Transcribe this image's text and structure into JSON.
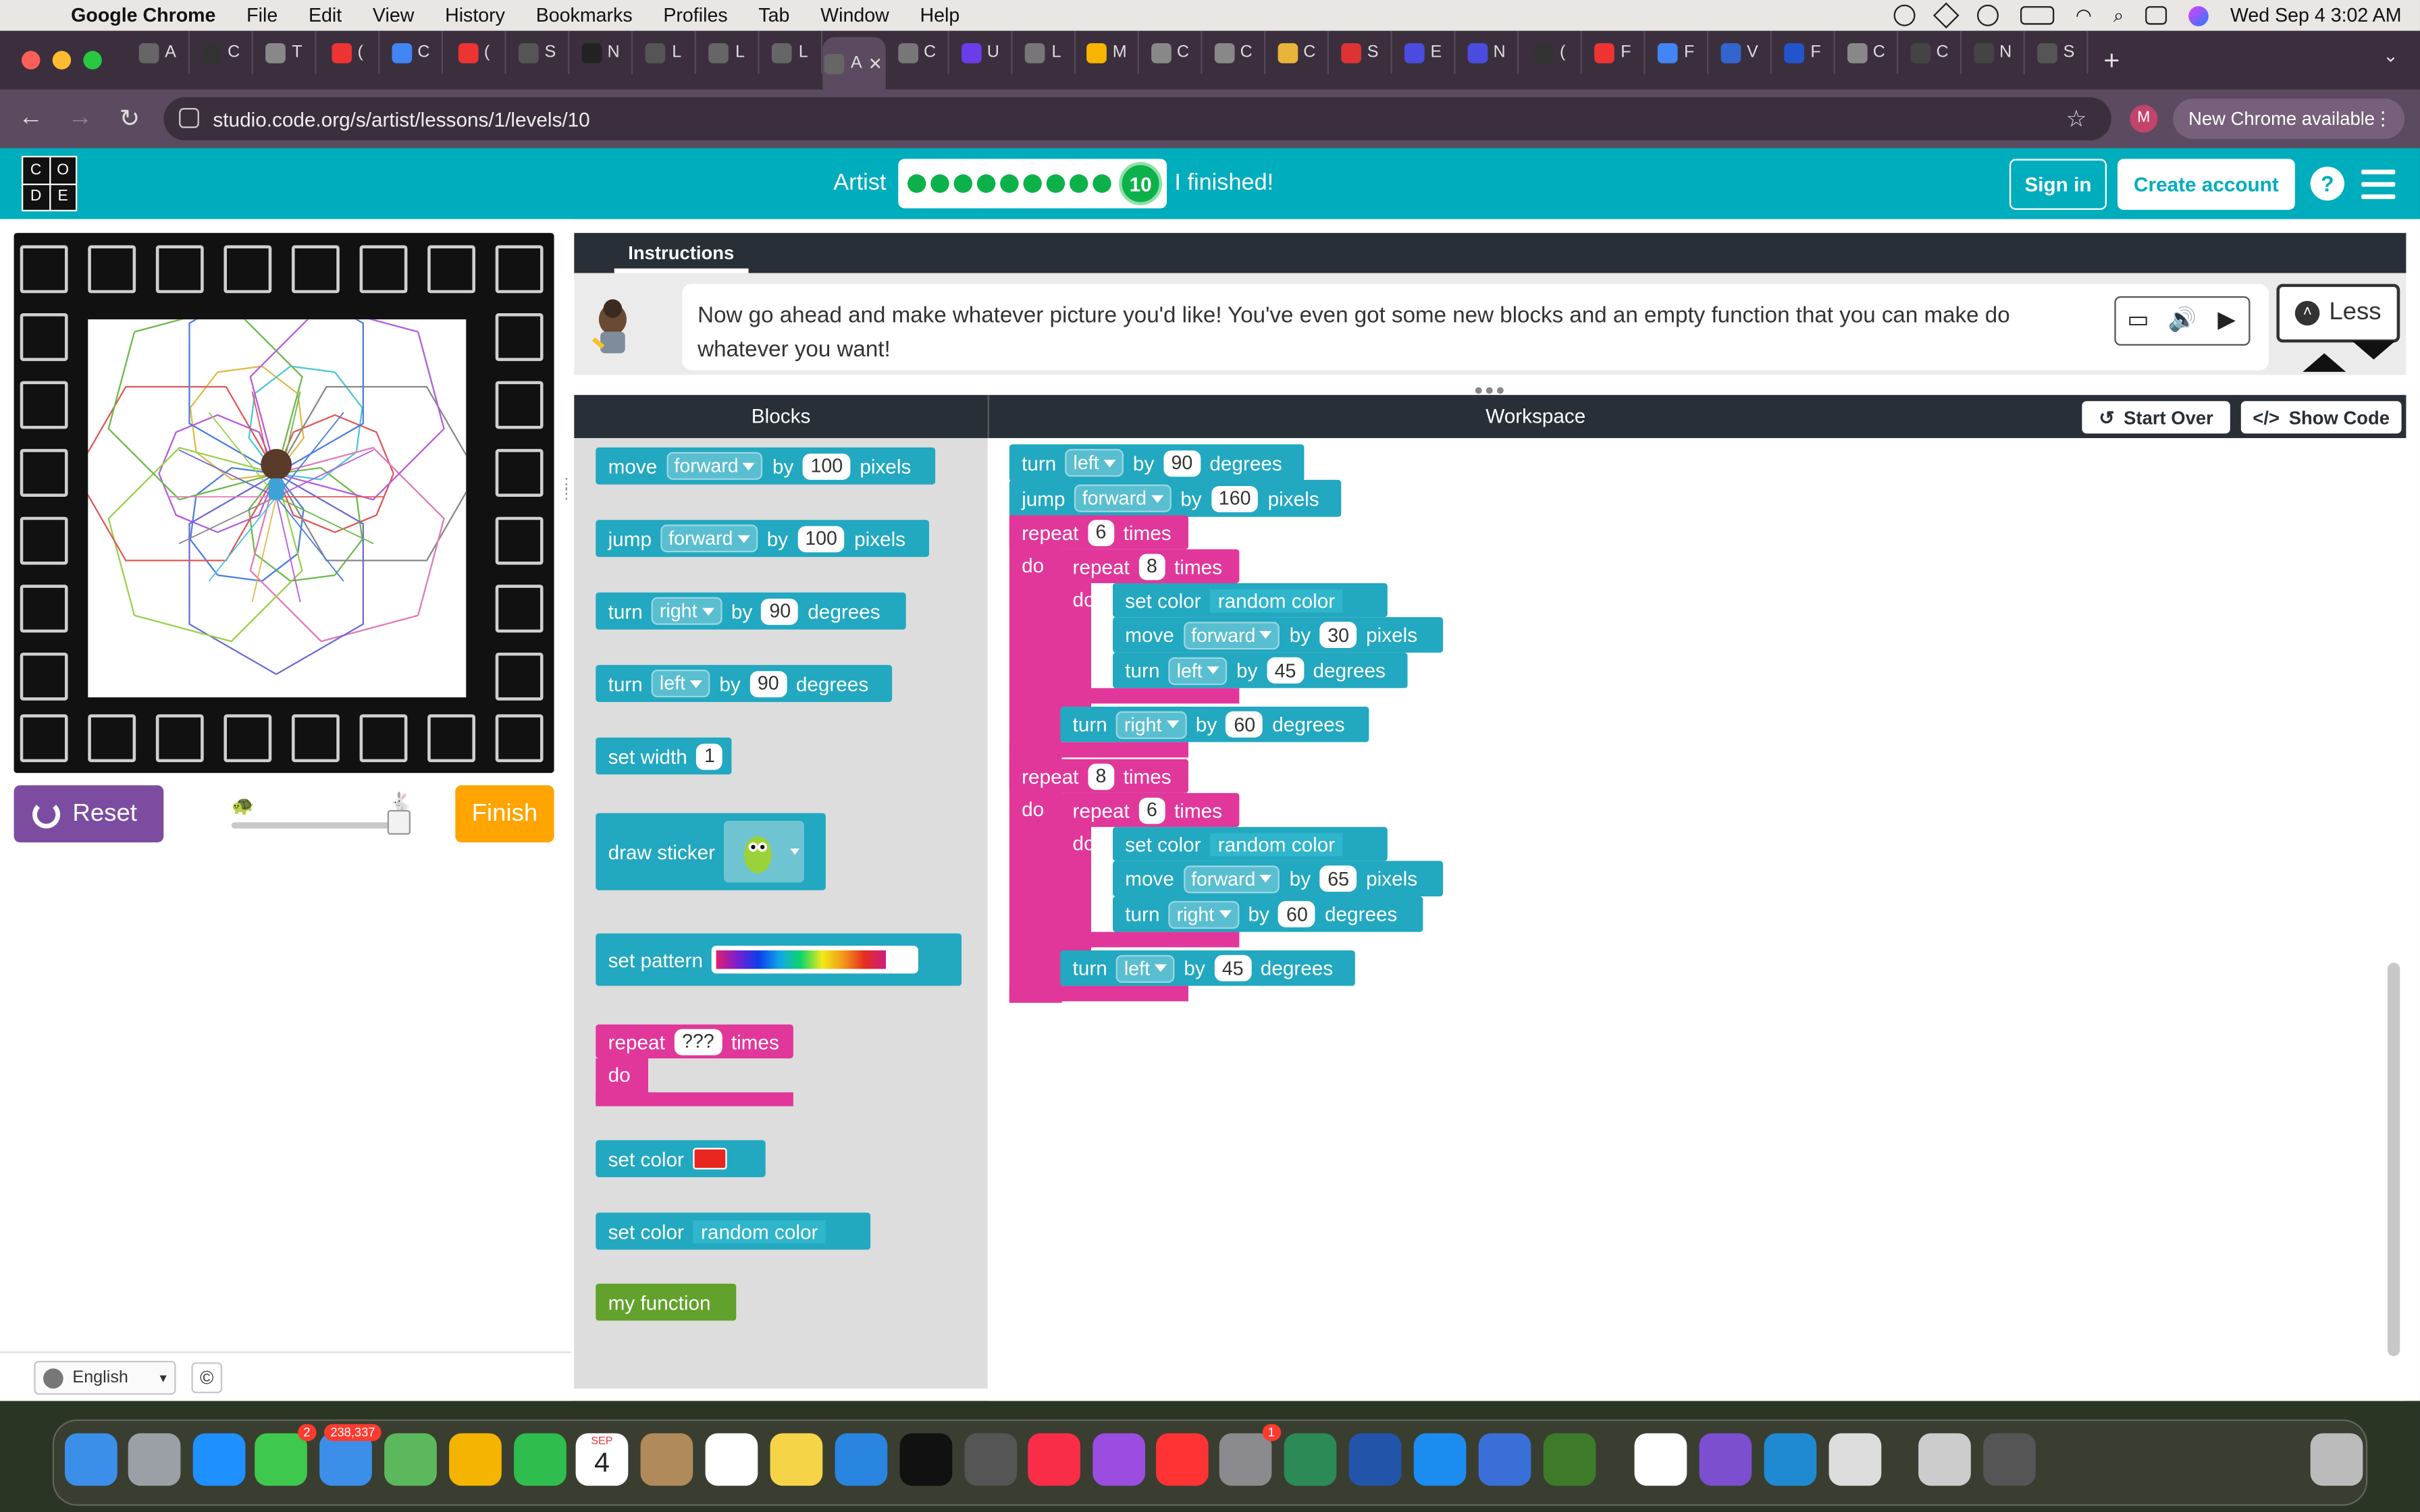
{
  "menubar": {
    "app": "Google Chrome",
    "items": [
      "File",
      "Edit",
      "View",
      "History",
      "Bookmarks",
      "Profiles",
      "Tab",
      "Window",
      "Help"
    ],
    "datetime": "Wed Sep 4  3:02 AM"
  },
  "browser": {
    "url": "studio.code.org/s/artist/lessons/1/levels/10",
    "new_chrome_label": "New Chrome available",
    "profile_initial": "M",
    "tab_letters": [
      "A",
      "C",
      "T",
      "(",
      "C",
      "(",
      "S",
      "N",
      "L",
      "L",
      "L",
      "A",
      "C",
      "U",
      "L",
      "M",
      "C",
      "C",
      "C",
      "S",
      "E",
      "N",
      "(",
      "F",
      "F",
      "V",
      "F",
      "C",
      "C",
      "N",
      "S"
    ]
  },
  "codeorg": {
    "logo_letters": [
      "C",
      "O",
      "D",
      "E"
    ],
    "level_title": "Artist",
    "current_level": "10",
    "finished_label": "I finished!",
    "sign_in": "Sign in",
    "create_account": "Create account",
    "help": "?"
  },
  "left_panel": {
    "reset_label": "Reset",
    "finish_label": "Finish",
    "speed_slider_level": 1.0,
    "language": "English",
    "copyright": "©"
  },
  "instructions": {
    "tab_label": "Instructions",
    "text": "Now go ahead and make whatever picture you'd like! You've even got some new blocks and an empty function that you can make do whatever you want!",
    "less_label": "Less"
  },
  "editor": {
    "blocks_header": "Blocks",
    "workspace_header": "Workspace",
    "start_over": "Start Over",
    "show_code": "Show Code"
  },
  "toolbox": {
    "move_forward": {
      "verb": "move",
      "dir": "forward",
      "by": "by",
      "val": "100",
      "unit": "pixels"
    },
    "jump_forward": {
      "verb": "jump",
      "dir": "forward",
      "by": "by",
      "val": "100",
      "unit": "pixels"
    },
    "turn_right": {
      "verb": "turn",
      "dir": "right",
      "by": "by",
      "val": "90",
      "unit": "degrees"
    },
    "turn_left": {
      "verb": "turn",
      "dir": "left",
      "by": "by",
      "val": "90",
      "unit": "degrees"
    },
    "set_width": {
      "label": "set width",
      "val": "1"
    },
    "draw_sticker": {
      "label": "draw sticker"
    },
    "set_pattern": {
      "label": "set pattern"
    },
    "repeat": {
      "label": "repeat",
      "val": "???",
      "times": "times",
      "do": "do"
    },
    "set_color_red": {
      "label": "set color",
      "color": "#e8261f"
    },
    "set_color_random": {
      "label": "set color",
      "val": "random color"
    },
    "my_function": {
      "label": "my function"
    }
  },
  "workspace": {
    "b1": {
      "verb": "turn",
      "dir": "left",
      "by": "by",
      "val": "90",
      "unit": "degrees"
    },
    "b2": {
      "verb": "jump",
      "dir": "forward",
      "by": "by",
      "val": "160",
      "unit": "pixels"
    },
    "r1": {
      "label": "repeat",
      "val": "6",
      "times": "times",
      "do": "do"
    },
    "r1a": {
      "label": "repeat",
      "val": "8",
      "times": "times",
      "do": "do"
    },
    "r1a_c": {
      "label": "set color",
      "val": "random color"
    },
    "r1a_m": {
      "verb": "move",
      "dir": "forward",
      "by": "by",
      "val": "30",
      "unit": "pixels"
    },
    "r1a_t": {
      "verb": "turn",
      "dir": "left",
      "by": "by",
      "val": "45",
      "unit": "degrees"
    },
    "r1_t": {
      "verb": "turn",
      "dir": "right",
      "by": "by",
      "val": "60",
      "unit": "degrees"
    },
    "r2": {
      "label": "repeat",
      "val": "8",
      "times": "times",
      "do": "do"
    },
    "r2a": {
      "label": "repeat",
      "val": "6",
      "times": "times",
      "do": "do"
    },
    "r2a_c": {
      "label": "set color",
      "val": "random color"
    },
    "r2a_m": {
      "verb": "move",
      "dir": "forward",
      "by": "by",
      "val": "65",
      "unit": "pixels"
    },
    "r2a_t": {
      "verb": "turn",
      "dir": "right",
      "by": "by",
      "val": "60",
      "unit": "degrees"
    },
    "r2_t": {
      "verb": "turn",
      "dir": "left",
      "by": "by",
      "val": "45",
      "unit": "degrees"
    }
  },
  "dock": {
    "calendar_month": "SEP",
    "calendar_day": "4",
    "messages_badge": "2",
    "mail_badge": "238,337",
    "settings_badge": "1"
  },
  "colors": {
    "header": "#00adbc",
    "block_blue": "#22a8c0",
    "block_pink": "#e1379b",
    "block_green": "#62a12b",
    "reset": "#7c4ca1",
    "finish": "#ffa400"
  }
}
